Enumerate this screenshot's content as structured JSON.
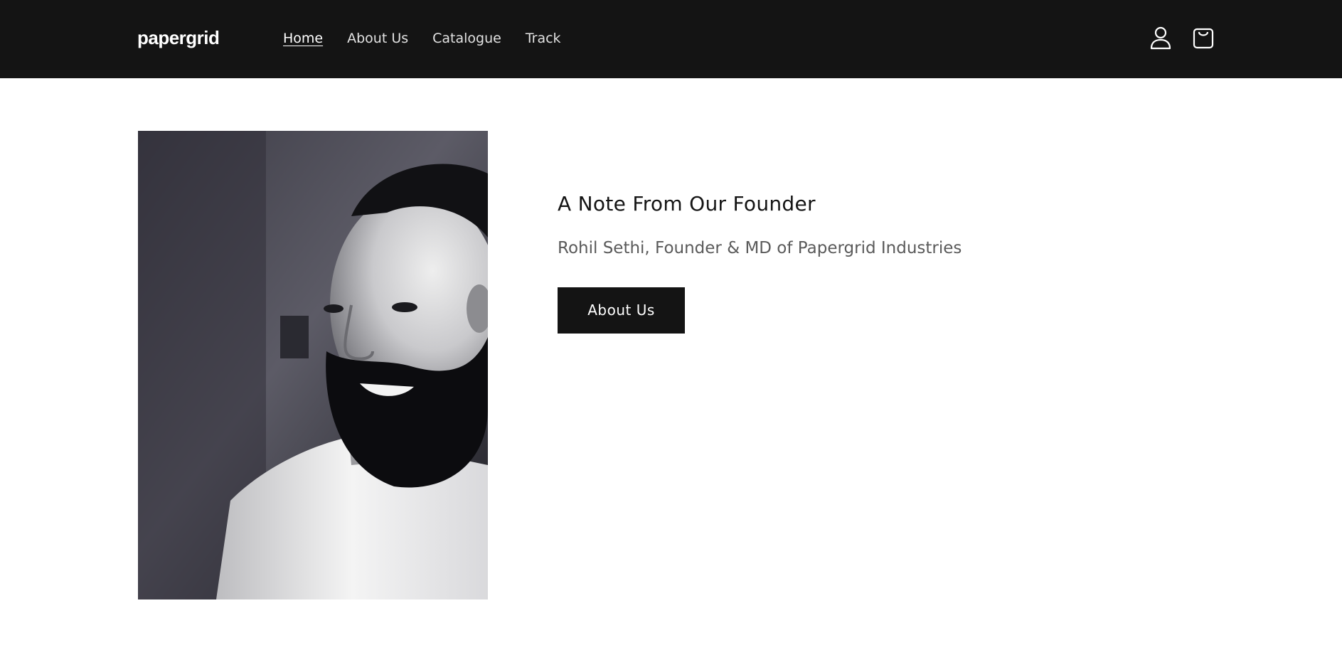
{
  "header": {
    "logo": "papergrid",
    "nav": {
      "home": "Home",
      "about": "About Us",
      "catalogue": "Catalogue",
      "track": "Track"
    },
    "icons": {
      "account": "account-icon",
      "cart": "cart-icon"
    }
  },
  "founder": {
    "heading": "A Note From Our Founder",
    "subtitle": "Rohil Sethi, Founder & MD of Papergrid Industries",
    "button_label": "About Us",
    "photo_alt": "Rohil Sethi"
  },
  "colors": {
    "header_bg": "#141414",
    "button_bg": "#141414",
    "text_dark": "#141414",
    "text_muted": "#5a5a5a"
  }
}
